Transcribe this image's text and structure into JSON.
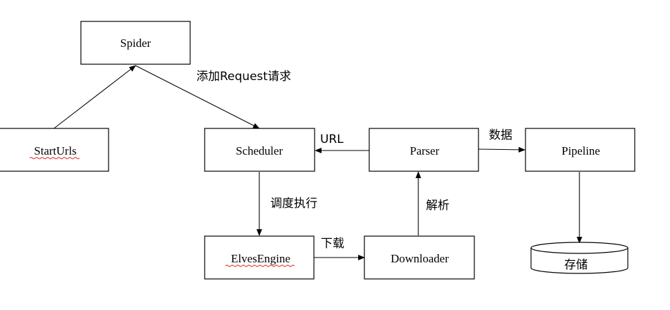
{
  "diagram": {
    "nodes": {
      "spider": {
        "label": "Spider"
      },
      "start_urls": {
        "label": "StartUrls"
      },
      "scheduler": {
        "label": "Scheduler"
      },
      "parser": {
        "label": "Parser"
      },
      "pipeline": {
        "label": "Pipeline"
      },
      "elves_engine": {
        "label": "ElvesEngine"
      },
      "downloader": {
        "label": "Downloader"
      },
      "storage": {
        "label": "存储"
      }
    },
    "edges": {
      "spider_to_scheduler": {
        "label": "添加Request请求"
      },
      "parser_to_scheduler": {
        "label": "URL"
      },
      "parser_to_pipeline": {
        "label": "数据"
      },
      "scheduler_to_engine": {
        "label": "调度执行"
      },
      "engine_to_downloader": {
        "label": "下载"
      },
      "downloader_to_parser": {
        "label": "解析"
      }
    },
    "colors": {
      "stroke": "#000000",
      "background": "#ffffff",
      "spellcheck_underline": "#e02020"
    }
  }
}
